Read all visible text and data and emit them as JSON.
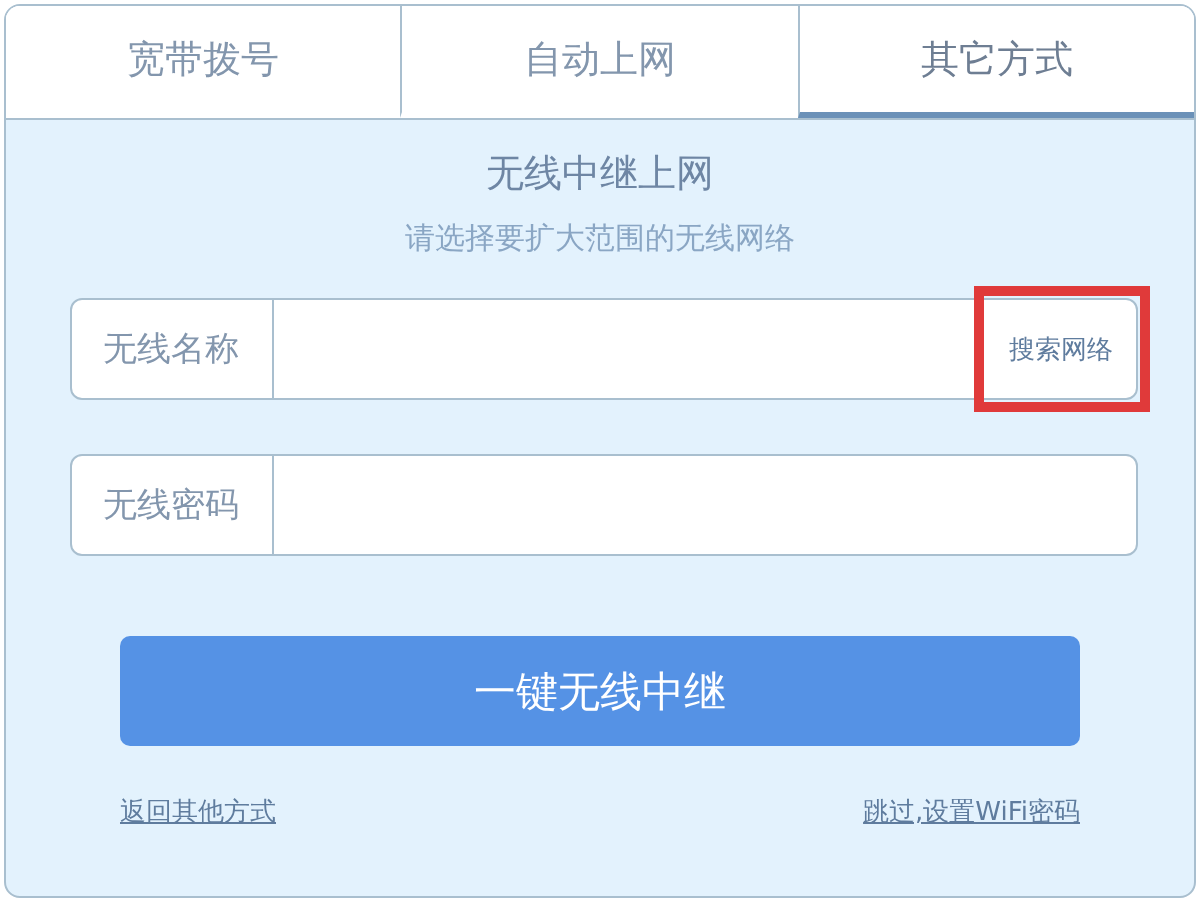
{
  "tabs": [
    {
      "label": "宽带拨号",
      "selected": false
    },
    {
      "label": "自动上网",
      "selected": false
    },
    {
      "label": "其它方式",
      "selected": true
    }
  ],
  "title": "无线中继上网",
  "subtitle": "请选择要扩大范围的无线网络",
  "fields": [
    {
      "label": "无线名称",
      "action": {
        "label": "搜索网络",
        "highlighted": true
      }
    },
    {
      "label": "无线密码"
    }
  ],
  "primary_button": "一键无线中继",
  "links": [
    "返回其他方式",
    "跳过,设置WiFi密码"
  ]
}
